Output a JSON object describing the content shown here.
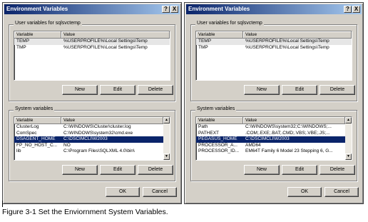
{
  "left_dialog": {
    "title": "Environment Variables",
    "help_glyph": "?",
    "close_glyph": "X",
    "user_group_label": "User variables for sqlsvctemp",
    "user_headers": [
      "Variable",
      "Value"
    ],
    "user_rows": [
      {
        "var": "TEMP",
        "val": "%USERPROFILE%\\Local Settings\\Temp"
      },
      {
        "var": "TMP",
        "val": "%USERPROFILE%\\Local Settings\\Temp"
      }
    ],
    "user_buttons": {
      "new": "New",
      "edit": "Edit",
      "delete": "Delete"
    },
    "sys_group_label": "System variables",
    "sys_headers": [
      "Variable",
      "Value"
    ],
    "sys_rows": [
      {
        "var": "ClusterLog",
        "val": "C:\\WINDOWS\\Cluster\\cluster.log"
      },
      {
        "var": "ComSpec",
        "val": "C:\\WINDOWS\\system32\\cmd.exe"
      },
      {
        "var": "DSAGENT_HOME",
        "val": "C:\\DSCIMCLI\\W2003"
      },
      {
        "var": "FP_NO_HOST_C...",
        "val": "NO"
      },
      {
        "var": "lib",
        "val": "C:\\Program Files\\SQLXML 4.0\\bin\\"
      }
    ],
    "sys_selected_index": 2,
    "sys_buttons": {
      "new": "New",
      "edit": "Edit",
      "delete": "Delete"
    },
    "ok": "OK",
    "cancel": "Cancel"
  },
  "right_dialog": {
    "title": "Environment Variables",
    "help_glyph": "?",
    "close_glyph": "X",
    "user_group_label": "User variables for sqlsvctemp",
    "user_headers": [
      "Variable",
      "Value"
    ],
    "user_rows": [
      {
        "var": "TEMP",
        "val": "%USERPROFILE%\\Local Settings\\Temp"
      },
      {
        "var": "TMP",
        "val": "%USERPROFILE%\\Local Settings\\Temp"
      }
    ],
    "user_buttons": {
      "new": "New",
      "edit": "Edit",
      "delete": "Delete"
    },
    "sys_group_label": "System variables",
    "sys_headers": [
      "Variable",
      "Value"
    ],
    "sys_rows": [
      {
        "var": "Path",
        "val": "C:\\WINDOWS\\system32;C:\\WINDOWS;..."
      },
      {
        "var": "PATHEXT",
        "val": ".COM;.EXE;.BAT;.CMD;.VBS;.VBE;.JS;..."
      },
      {
        "var": "PEGASUS_HOME",
        "val": "C:\\DSCIMCLI\\W2003"
      },
      {
        "var": "PROCESSOR_A...",
        "val": "AMD64"
      },
      {
        "var": "PROCESSOR_ID...",
        "val": "EM64T Family 6 Model 23 Stepping 6, G..."
      }
    ],
    "sys_selected_index": 2,
    "sys_buttons": {
      "new": "New",
      "edit": "Edit",
      "delete": "Delete"
    },
    "ok": "OK",
    "cancel": "Cancel"
  },
  "caption": "Figure 3-1 Set the Enviornment System Variables.",
  "colors": {
    "dialog_bg": "#d4d0c8",
    "title_start": "#0a246a",
    "title_end": "#a6caf0",
    "selection": "#0a246a"
  }
}
